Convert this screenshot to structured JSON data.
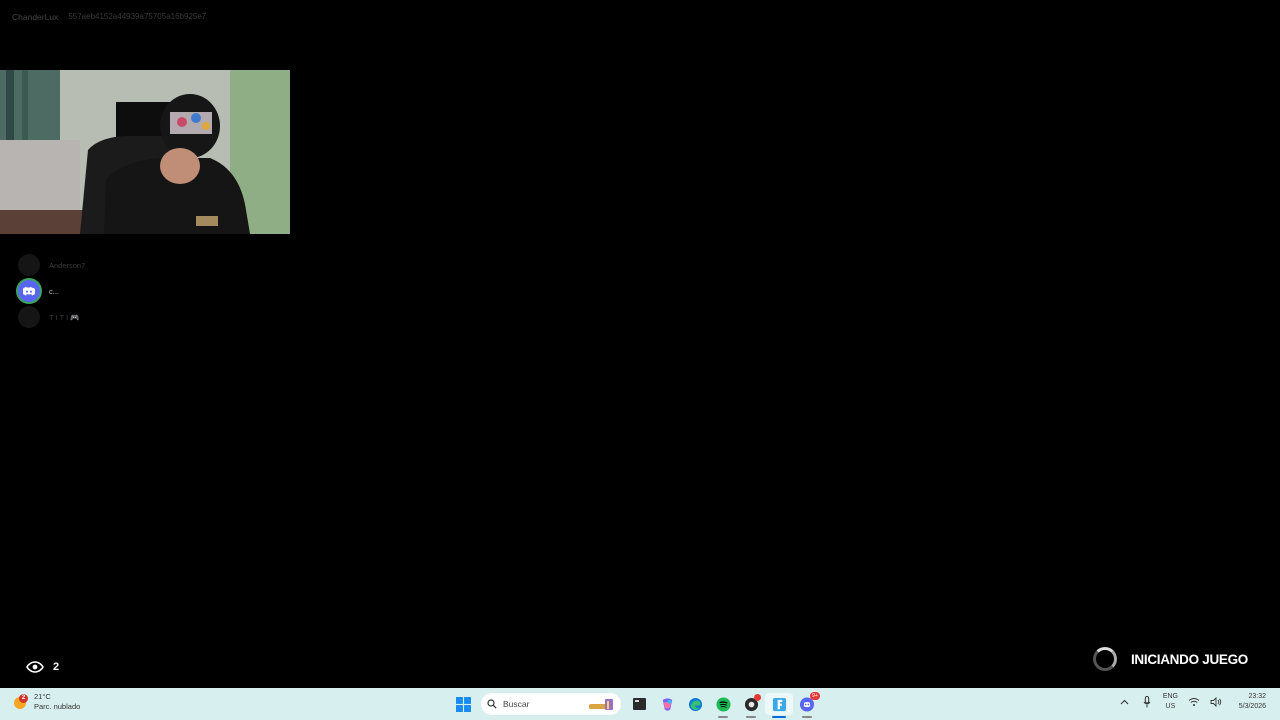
{
  "overlay": {
    "username": "ChanderLux",
    "session_id": "557aeb4152a44939a75705a16b925e7"
  },
  "voice_participants": [
    {
      "name": "Anderson7",
      "speaking": false
    },
    {
      "name": "c...",
      "speaking": true
    },
    {
      "name": "T I T I 🎮",
      "speaking": false
    }
  ],
  "viewers": {
    "count": "2",
    "icon": "eye-icon"
  },
  "launch_status": {
    "text": "INICIANDO JUEGO",
    "icon": "loading-spinner"
  },
  "taskbar": {
    "weather": {
      "temp": "21°C",
      "condition": "Parc. nublado",
      "badge": "2"
    },
    "search_placeholder": "Buscar",
    "apps": [
      "windows-start-icon",
      "search-icon",
      "file-explorer-icon",
      "copilot-icon",
      "edge-icon",
      "spotify-icon",
      "app-icon",
      "fortnite-icon",
      "discord-icon"
    ],
    "discord_badge": "9+",
    "tray": {
      "lang_top": "ENG",
      "lang_bottom": "US",
      "time": "23:32",
      "date": "5/3/2026"
    }
  },
  "colors": {
    "taskbar_bg": "#d7f0ef",
    "discord_blurple": "#5865f2",
    "speaking_ring": "#3ba55d",
    "background": "#000000"
  }
}
